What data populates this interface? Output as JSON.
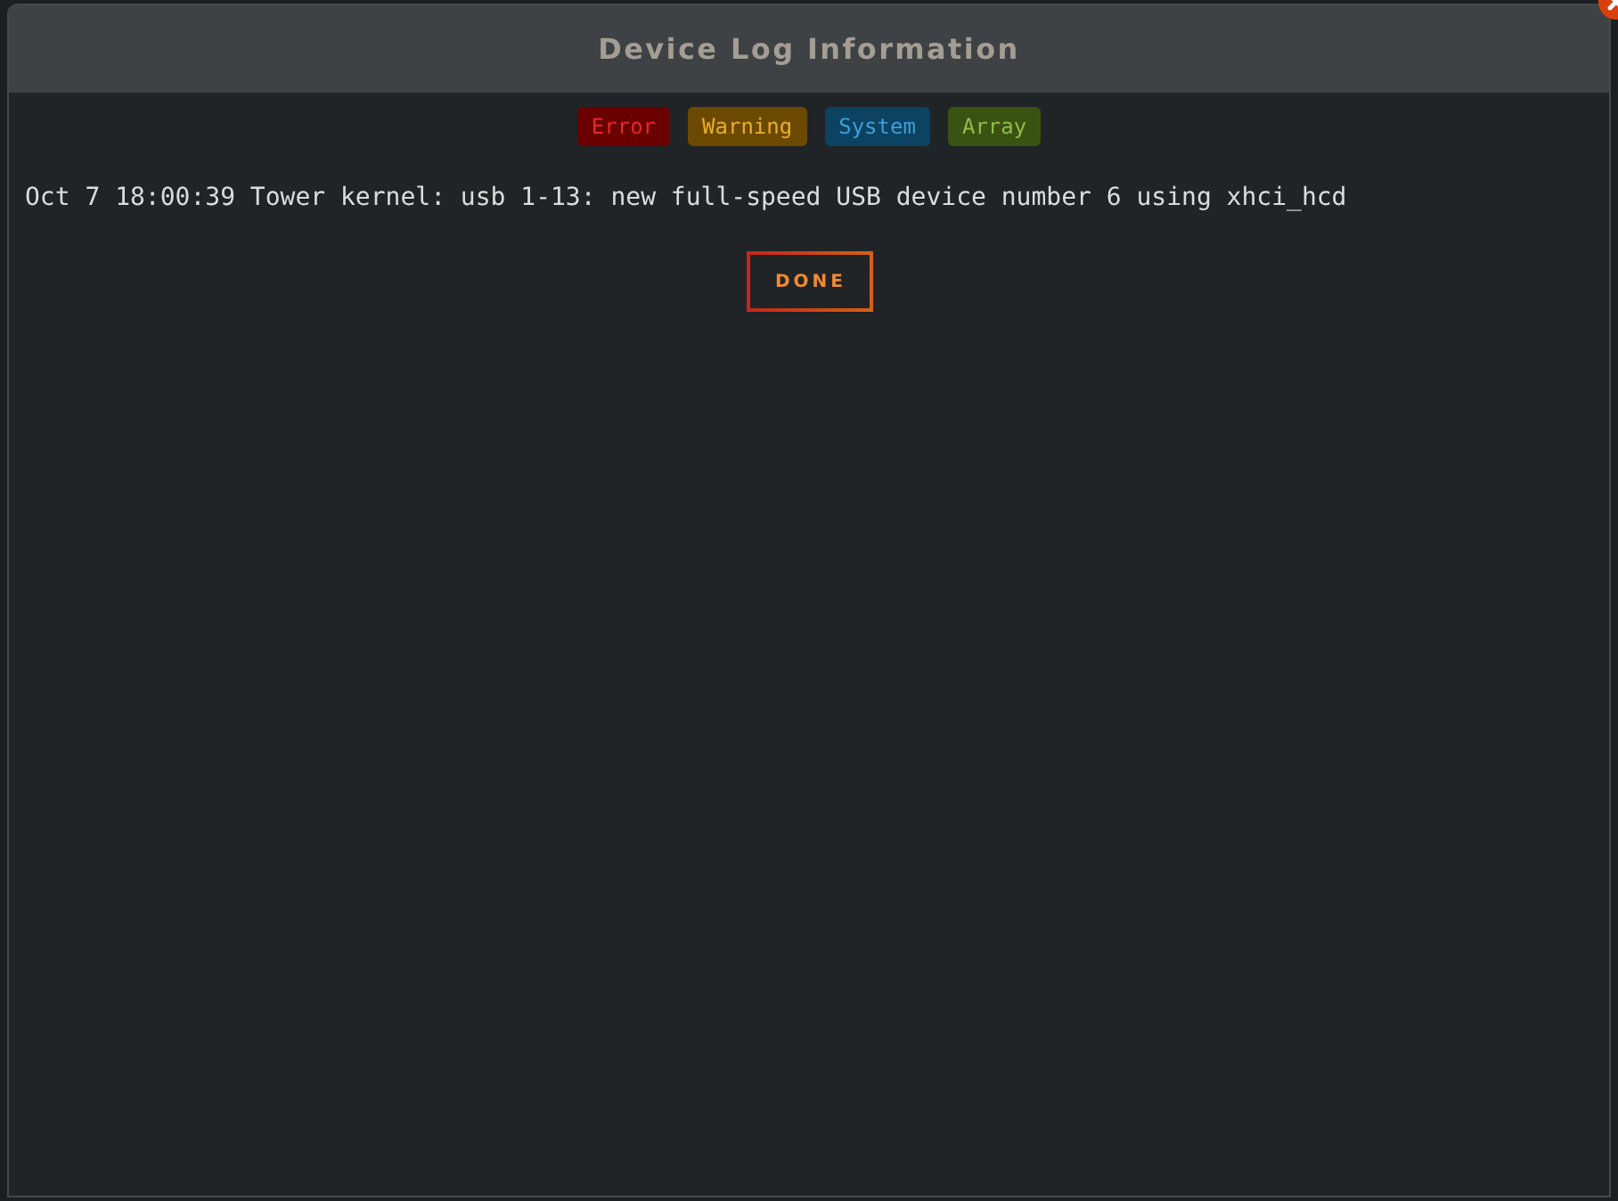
{
  "window": {
    "title": "Device Log Information"
  },
  "legend": [
    {
      "label": "Error",
      "color": "#6a0000"
    },
    {
      "label": "Warning",
      "color": "#6b4a00"
    },
    {
      "label": "System",
      "color": "#0c4262"
    },
    {
      "label": "Array",
      "color": "#3a5212"
    }
  ],
  "log_lines": [
    "Oct 7 18:00:39 Tower kernel: usb 1-13: new full-speed USB device number 6 using xhci_hcd"
  ],
  "buttons": [
    {
      "label": "DONE"
    }
  ]
}
